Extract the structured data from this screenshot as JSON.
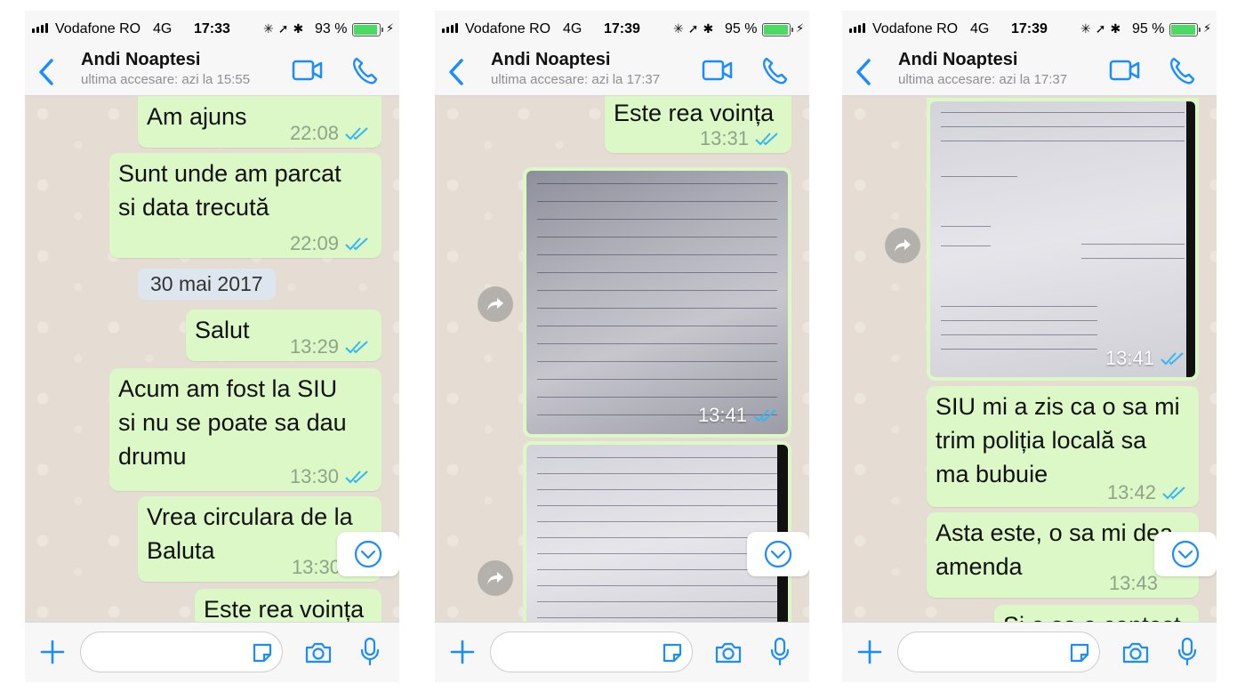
{
  "colors": {
    "accent": "#1a8cff",
    "bubble_out": "#dcf8c6",
    "chat_bg": "#e5ddd3",
    "tick_read": "#34b7f1"
  },
  "phones": [
    {
      "status": {
        "carrier": "Vodafone RO",
        "network": "4G",
        "time": "17:33",
        "battery": "93 %",
        "battery_level": 0.93
      },
      "header": {
        "name": "Andi Noaptesi",
        "last_seen": "ultima accesare: azi la 15:55"
      },
      "messages": [
        {
          "text": "Am ajuns",
          "time": "22:08"
        },
        {
          "text": "Sunt unde am parcat\nsi data trecută",
          "time": "22:09"
        },
        {
          "text": "Salut",
          "time": "13:29"
        },
        {
          "text": "Acum am fost la SIU\nsi nu se poate sa dau\ndrumu",
          "time": "13:30"
        },
        {
          "text": "Vrea circulara de la\nBaluta",
          "time": "13:30"
        },
        {
          "text": "Este rea voința",
          "time": ""
        }
      ],
      "date_separator": "30 mai 2017"
    },
    {
      "status": {
        "carrier": "Vodafone RO",
        "network": "4G",
        "time": "17:39",
        "battery": "95 %",
        "battery_level": 0.95
      },
      "header": {
        "name": "Andi Noaptesi",
        "last_seen": "ultima accesare: azi la 17:37"
      },
      "messages": [
        {
          "text": "Este rea voința",
          "time": "13:31"
        }
      ],
      "images": [
        {
          "time": "13:41"
        },
        {
          "time": ""
        }
      ]
    },
    {
      "status": {
        "carrier": "Vodafone RO",
        "network": "4G",
        "time": "17:39",
        "battery": "95 %",
        "battery_level": 0.95
      },
      "header": {
        "name": "Andi Noaptesi",
        "last_seen": "ultima accesare: azi la 17:37"
      },
      "images": [
        {
          "time": "13:41"
        }
      ],
      "messages": [
        {
          "text": "SIU mi a zis ca o sa mi\ntrim poliția locală sa\nma bubuie",
          "time": "13:42"
        },
        {
          "text": "Asta este, o sa mi dea\namenda",
          "time": "13:43"
        },
        {
          "text": "Si o sa o contest",
          "time": ""
        }
      ]
    }
  ]
}
